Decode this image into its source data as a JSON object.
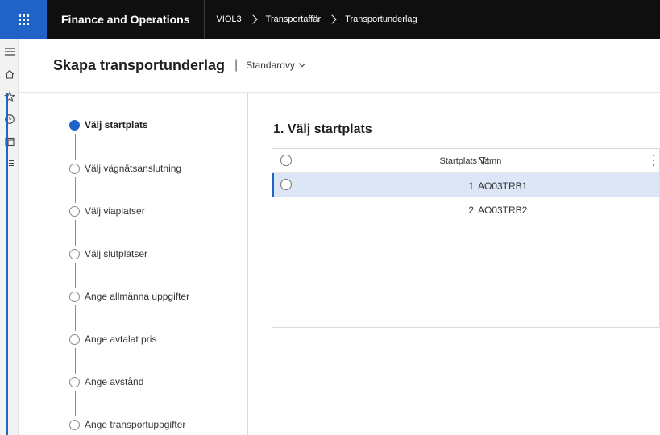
{
  "topbar": {
    "app_title": "Finance and Operations",
    "breadcrumb": [
      "VIOL3",
      "Transportaffär",
      "Transportunderlag"
    ]
  },
  "rail": {
    "icons": [
      "hamburger-icon",
      "home-icon",
      "star-icon",
      "clock-icon",
      "workspace-icon",
      "list-icon"
    ]
  },
  "header": {
    "title": "Skapa transportunderlag",
    "separator": "|",
    "view": "Standardvy"
  },
  "steps": [
    {
      "label": "Välj startplats",
      "active": true
    },
    {
      "label": "Välj vägnätsanslutning",
      "active": false
    },
    {
      "label": "Välj viaplatser",
      "active": false
    },
    {
      "label": "Välj slutplatser",
      "active": false
    },
    {
      "label": "Ange allmänna uppgifter",
      "active": false
    },
    {
      "label": "Ange avtalat pris",
      "active": false
    },
    {
      "label": "Ange avstånd",
      "active": false
    },
    {
      "label": "Ange transportuppgifter",
      "active": false
    }
  ],
  "main": {
    "section_title": "1. Välj startplats",
    "grid": {
      "columns": [
        "Startplats",
        "Namn"
      ],
      "rows": [
        {
          "startplats": "1",
          "namn": "AO03TRB1",
          "selected": true
        },
        {
          "startplats": "2",
          "namn": "AO03TRB2",
          "selected": false
        }
      ]
    }
  },
  "colors": {
    "accent": "#1f63c6",
    "topbar": "#0f0f0f",
    "selected_row": "#dce6f6"
  }
}
